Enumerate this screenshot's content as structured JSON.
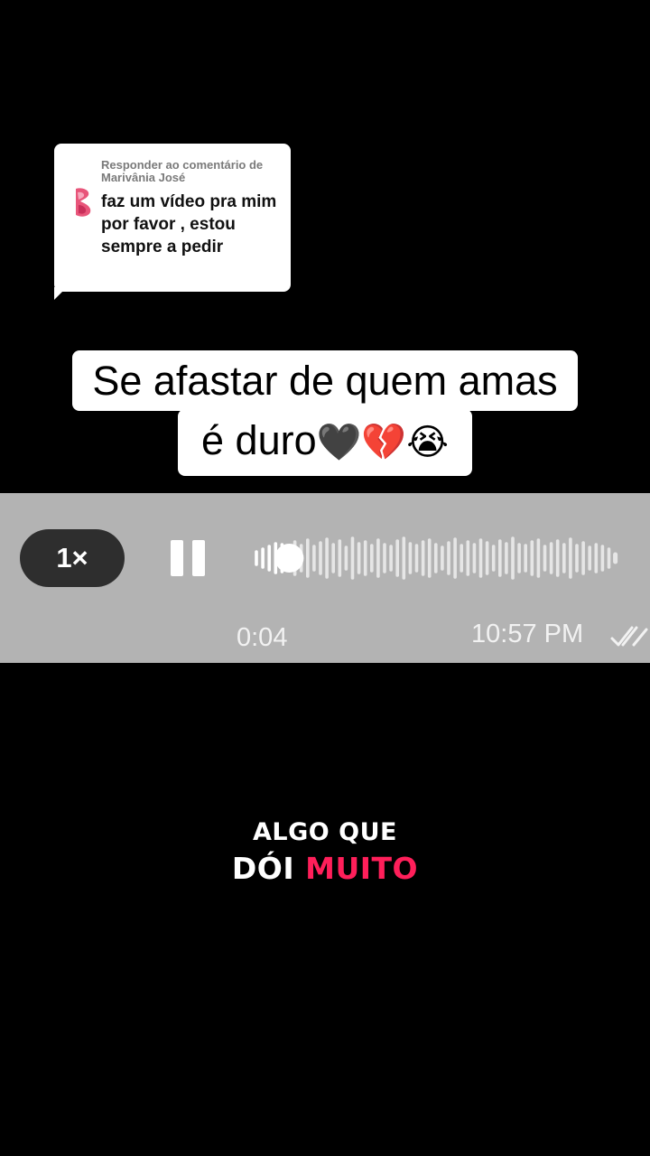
{
  "reply": {
    "header": "Responder ao comentário de Marivânia José",
    "comment": "faz um vídeo pra mim por favor , estou sempre a pedir"
  },
  "caption": {
    "line1": "Se afastar de quem amas",
    "line2_text": "é duro",
    "line2_emoji": "🖤💔😭"
  },
  "audio_message": {
    "speed_label": "1×",
    "playback_state": "playing",
    "progress_fraction": 0.09,
    "elapsed": "0:04",
    "sent_time": "10:57 PM",
    "read_status_icon": "double-check-icon"
  },
  "overlay_text": {
    "line1": "ALGO QUE",
    "line2_word1": "DÓI",
    "line2_word2": "MUITO",
    "accent_color": "#ff1f5a"
  }
}
